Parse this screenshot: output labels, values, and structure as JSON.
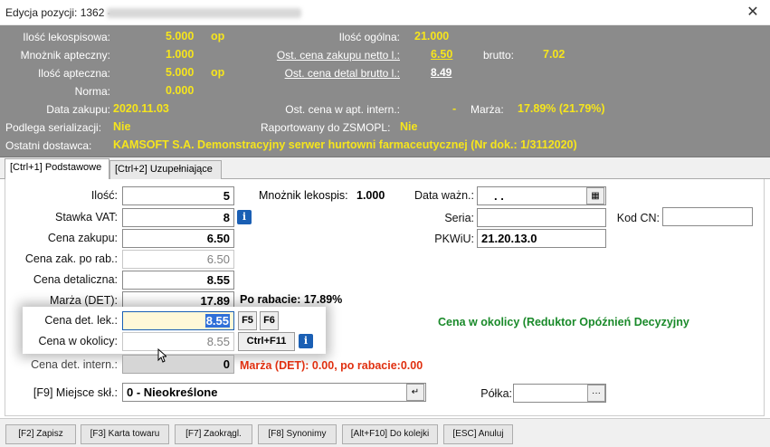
{
  "window": {
    "title": "Edycja pozycji: 1362 -",
    "close_symbol": "✕"
  },
  "info": {
    "ilosc_lekospisowa_label": "Ilość lekospisowa:",
    "ilosc_lekospisowa_value": "5.000",
    "ilosc_lekospisowa_unit": "op",
    "mnoznik_apteczny_label": "Mnożnik apteczny:",
    "mnoznik_apteczny_value": "1.000",
    "ilosc_apteczna_label": "Ilość apteczna:",
    "ilosc_apteczna_value": "5.000",
    "ilosc_apteczna_unit": "op",
    "norma_label": "Norma:",
    "norma_value": "0.000",
    "data_zakupu_label": "Data zakupu:",
    "data_zakupu_value": "2020.11.03",
    "podlega_serializacji_label": "Podlega serializacji:",
    "podlega_serializacji_value": "Nie",
    "ostatni_dostawca_label": "Ostatni dostawca:",
    "ostatni_dostawca_value": "KAMSOFT S.A. Demonstracyjny serwer hurtowni farmaceutycznej  (Nr dok.: 1/3112020)",
    "ilosc_ogolna_label": "Ilość ogólna:",
    "ilosc_ogolna_value": "21.000",
    "ost_cena_zakupu_label": "Ost. cena zakupu netto l.:",
    "ost_cena_zakupu_value": "6.50",
    "brutto_label": "brutto:",
    "brutto_value": "7.02",
    "ost_cena_detal_label": "Ost. cena detal brutto l.:",
    "ost_cena_detal_value": "8.49",
    "ost_cena_apt_label": "Ost. cena w apt. intern.:",
    "ost_cena_apt_value": "-",
    "marza_label": "Marża:",
    "marza_value": "17.89% (21.79%)",
    "raportowany_label": "Raportowany do ZSMOPL:",
    "raportowany_value": "Nie"
  },
  "tabs": [
    {
      "label": "[Ctrl+1] Podstawowe"
    },
    {
      "label": "[Ctrl+2] Uzupełniające"
    }
  ],
  "form": {
    "ilosc_label": "Ilość:",
    "ilosc_value": "5",
    "stawka_vat_label": "Stawka VAT:",
    "stawka_vat_value": "8",
    "cena_zakupu_label": "Cena zakupu:",
    "cena_zakupu_value": "6.50",
    "cena_zak_po_rab_label": "Cena zak. po rab.:",
    "cena_zak_po_rab_value": "6.50",
    "cena_detaliczna_label": "Cena detaliczna:",
    "cena_detaliczna_value": "8.55",
    "marza_det_label": "Marża (DET):",
    "marza_det_value": "17.89",
    "po_rabacie_text": "Po rabacie: 17.89%",
    "cena_det_lek_label": "Cena det. lek.:",
    "cena_det_lek_value": "8.55",
    "f5_label": "F5",
    "f6_label": "F6",
    "cena_w_okolicy_label": "Cena w okolicy:",
    "cena_w_okolicy_value": "8.55",
    "ctrl_f11_label": "Ctrl+F11",
    "cena_det_intern_label": "Cena det. intern.:",
    "cena_det_intern_value": "0",
    "marza_warning": "Marża (DET): 0.00, po rabacie:0.00",
    "cena_w_okolicy_note": "Cena w okolicy (Reduktor Opóźnień Decyzyjny",
    "mnoznik_lekospis_label": "Mnożnik lekospis:",
    "mnoznik_lekospis_value": "1.000",
    "data_wazn_label": "Data ważn.:",
    "data_wazn_value": ". .",
    "seria_label": "Seria:",
    "seria_value": "",
    "kod_cn_label": "Kod CN:",
    "kod_cn_value": "",
    "pkwiu_label": "PKWiU:",
    "pkwiu_value": "21.20.13.0",
    "miejsce_skl_label": "[F9] Miejsce skł.:",
    "miejsce_skl_value": "0 - Nieokreślone",
    "polka_label": "Półka:",
    "polka_value": "",
    "info_icon_symbol": "i",
    "calendar_symbol": "▦",
    "ellipsis_symbol": "···",
    "back_arrow_symbol": "↵"
  },
  "bottom_buttons": [
    {
      "label": "[F2] Zapisz"
    },
    {
      "label": "[F3] Karta towaru"
    },
    {
      "label": "[F7] Zaokrągl."
    },
    {
      "label": "[F8] Synonimy"
    },
    {
      "label": "[Alt+F10] Do kolejki"
    },
    {
      "label": "[ESC] Anuluj"
    }
  ],
  "colors": {
    "info_bg": "#8b8b8b",
    "highlight_yellow": "#f6e51c",
    "warning_red": "#e03010",
    "note_green": "#1a8a2a",
    "info_icon_blue": "#1a5fb4"
  }
}
